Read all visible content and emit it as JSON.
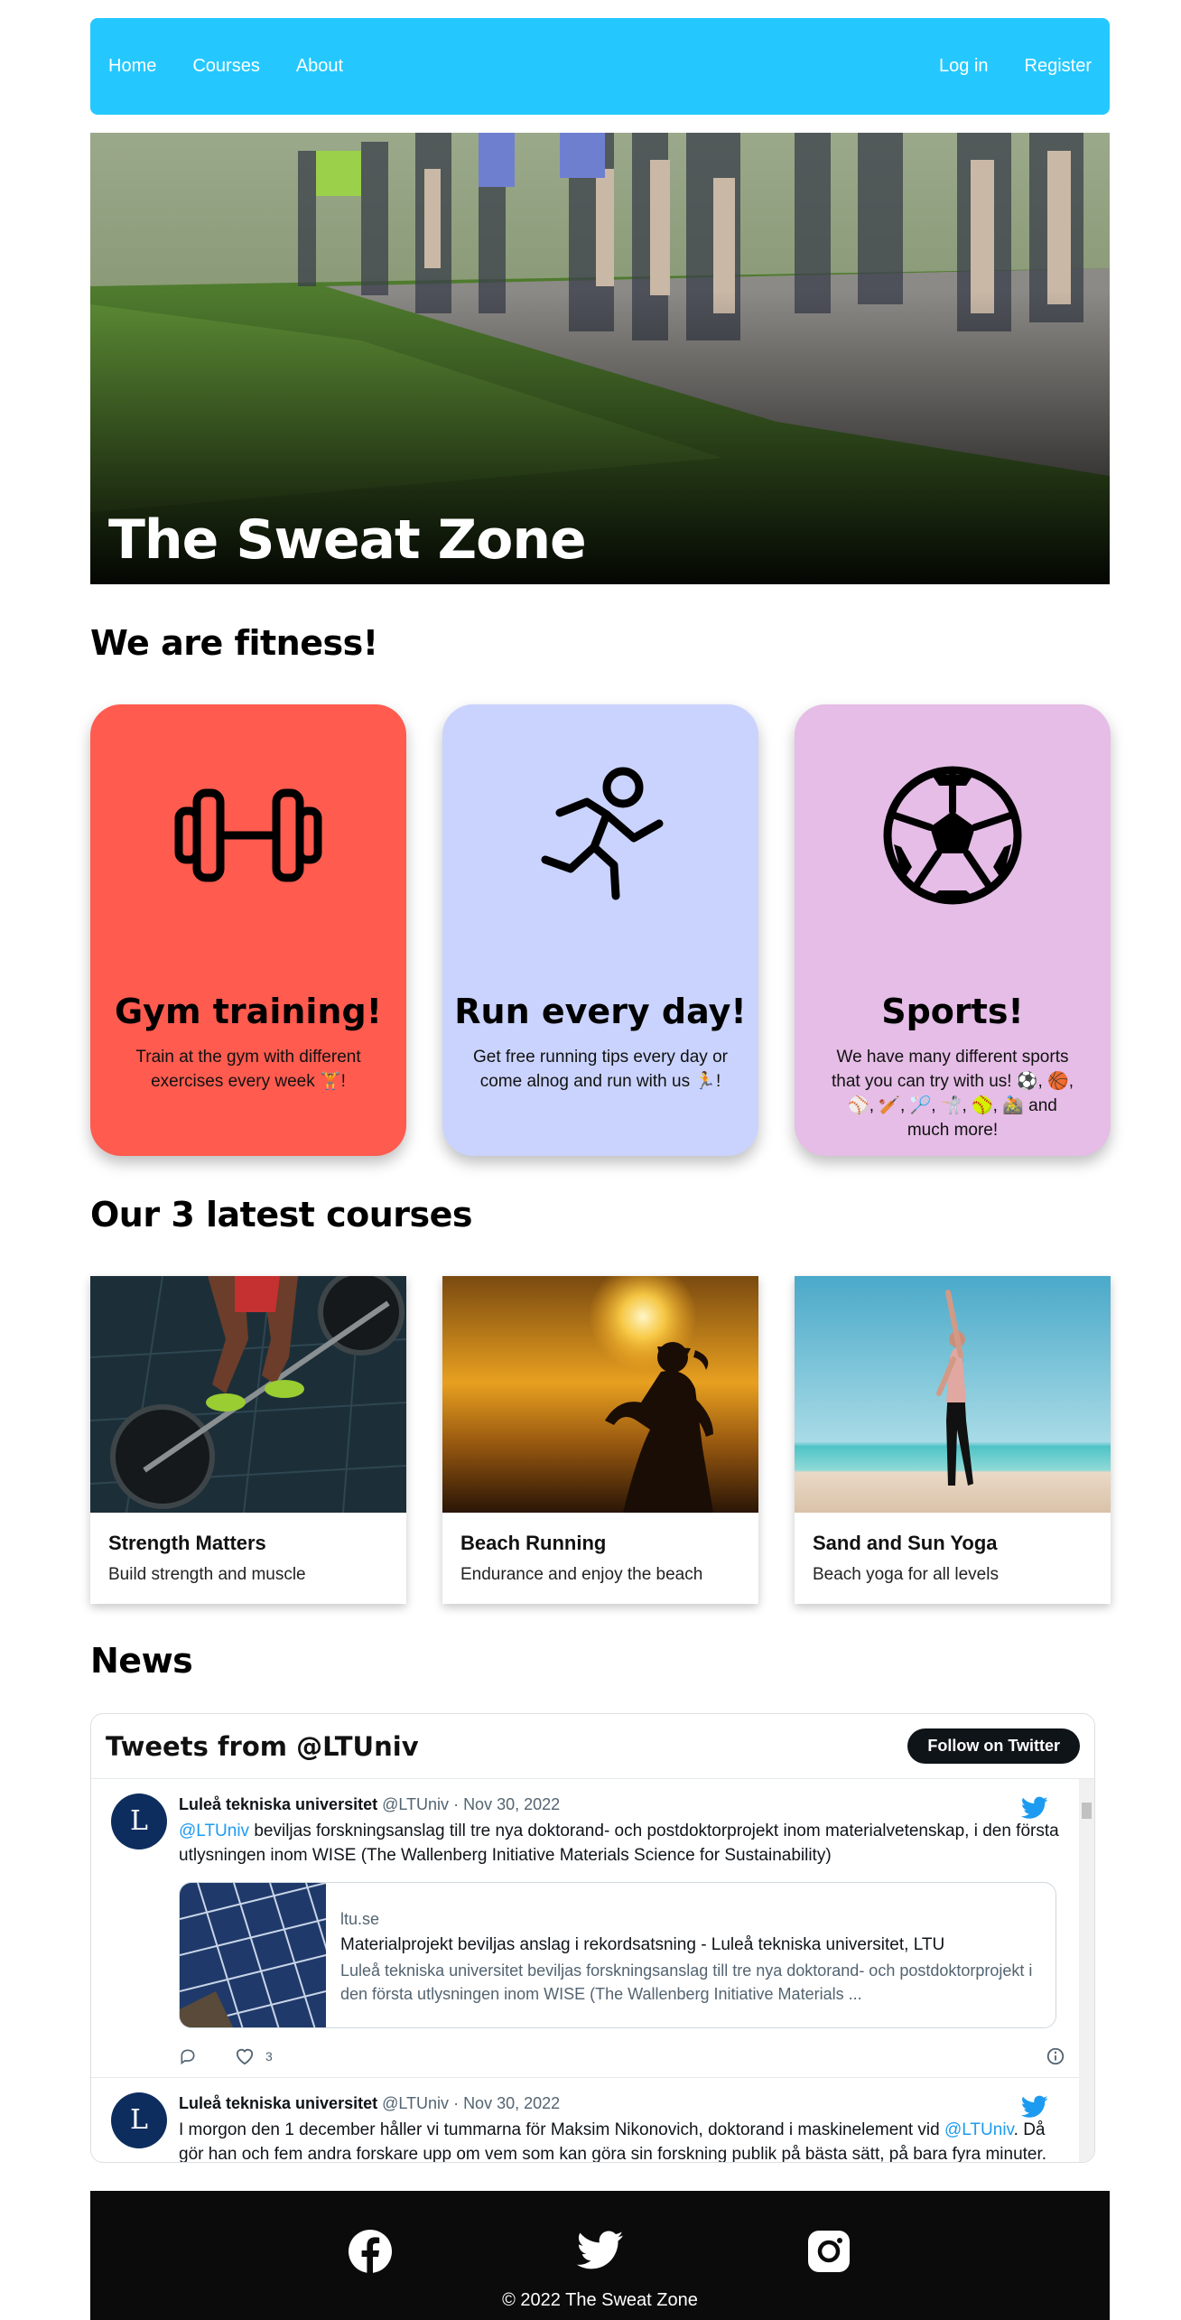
{
  "nav": {
    "left": [
      "Home",
      "Courses",
      "About"
    ],
    "right": [
      "Log in",
      "Register"
    ],
    "bg_color": "#24c8ff"
  },
  "hero": {
    "title": "The Sweat Zone"
  },
  "intro_heading": "We are fitness!",
  "features": [
    {
      "icon": "dumbbell-icon",
      "title": "Gym training!",
      "text": "Train at the gym with different exercises every week 🏋️!",
      "color": "#ff5b4f"
    },
    {
      "icon": "runner-icon",
      "title": "Run every day!",
      "text": "Get free running tips every day or come alnog and run with us 🏃!",
      "color": "#cad3fd"
    },
    {
      "icon": "soccer-ball-icon",
      "title": "Sports!",
      "text": "We have many different sports that you can try with us! ⚽, 🏀, ⚾, 🏏, 🏸, 🤺, 🥎, 🚵 and much more!",
      "color": "#e5bde6"
    }
  ],
  "courses_heading": "Our 3 latest courses",
  "courses": [
    {
      "title": "Strength Matters",
      "subtitle": "Build strength and muscle"
    },
    {
      "title": "Beach Running",
      "subtitle": "Endurance and enjoy the beach"
    },
    {
      "title": "Sand and Sun Yoga",
      "subtitle": "Beach yoga for all levels"
    }
  ],
  "news_heading": "News",
  "twitter": {
    "header": "Tweets from @LTUniv",
    "follow_label": "Follow on Twitter",
    "tweets": [
      {
        "name": "Luleå tekniska universitet",
        "handle": "@LTUniv",
        "date": "Nov 30, 2022",
        "mention": "@LTUniv",
        "text": " beviljas forskningsanslag till tre nya doktorand- och postdoktorprojekt inom materialvetenskap, i den första utlysningen inom WISE (The Wallenberg Initiative Materials Science for Sustainability)",
        "card": {
          "domain": "ltu.se",
          "title": "Materialprojekt beviljas anslag i rekordsatsning - Luleå tekniska universitet, LTU",
          "desc": "Luleå tekniska universitet beviljas forskningsanslag till tre nya doktorand- och postdoktorprojekt i den första utlysningen inom WISE (The Wallenberg Initiative Materials ..."
        },
        "likes": "3"
      },
      {
        "name": "Luleå tekniska universitet",
        "handle": "@LTUniv",
        "date": "Nov 30, 2022",
        "text_before": "I morgon den 1 december håller vi tummarna för Maksim Nikonovich, doktorand i maskinelement vid ",
        "mention": "@LTUniv",
        "text_after": ". Då gör han och fem andra forskare upp om vem som kan göra sin forskning publik på bästa sätt, på bara fyra minuter."
      }
    ]
  },
  "footer": {
    "copyright": "© 2022 The Sweat Zone",
    "icons": [
      "facebook-icon",
      "twitter-icon",
      "instagram-icon"
    ]
  }
}
